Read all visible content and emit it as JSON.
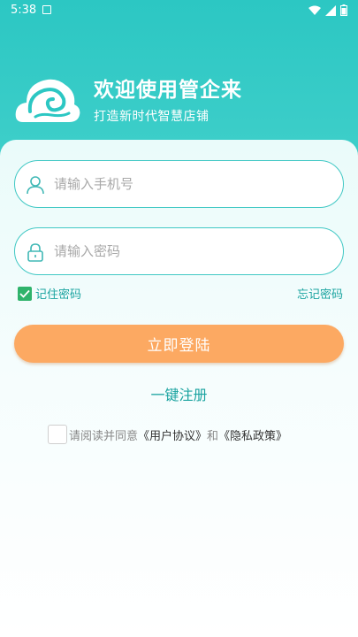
{
  "status_bar": {
    "time": "5:38"
  },
  "brand": {
    "title": "欢迎使用管企来",
    "subtitle": "打造新时代智慧店铺"
  },
  "phone_field": {
    "placeholder": "请输入手机号",
    "icon": "user-icon"
  },
  "password_field": {
    "placeholder": "请输入密码",
    "icon": "lock-icon"
  },
  "remember": {
    "label": "记住密码",
    "checked": true
  },
  "forgot_label": "忘记密码",
  "login_label": "立即登陆",
  "register_label": "一键注册",
  "agreement": {
    "checked": false,
    "prefix": "请阅读并同意",
    "user_agreement": "《用户协议》",
    "conjunction": "和",
    "privacy_policy": "《隐私政策》"
  },
  "colors": {
    "header": "#2cc7c3",
    "accent_text": "#1aa3a0",
    "login_button": "#fca962",
    "checkbox_green": "#2fb36b"
  }
}
